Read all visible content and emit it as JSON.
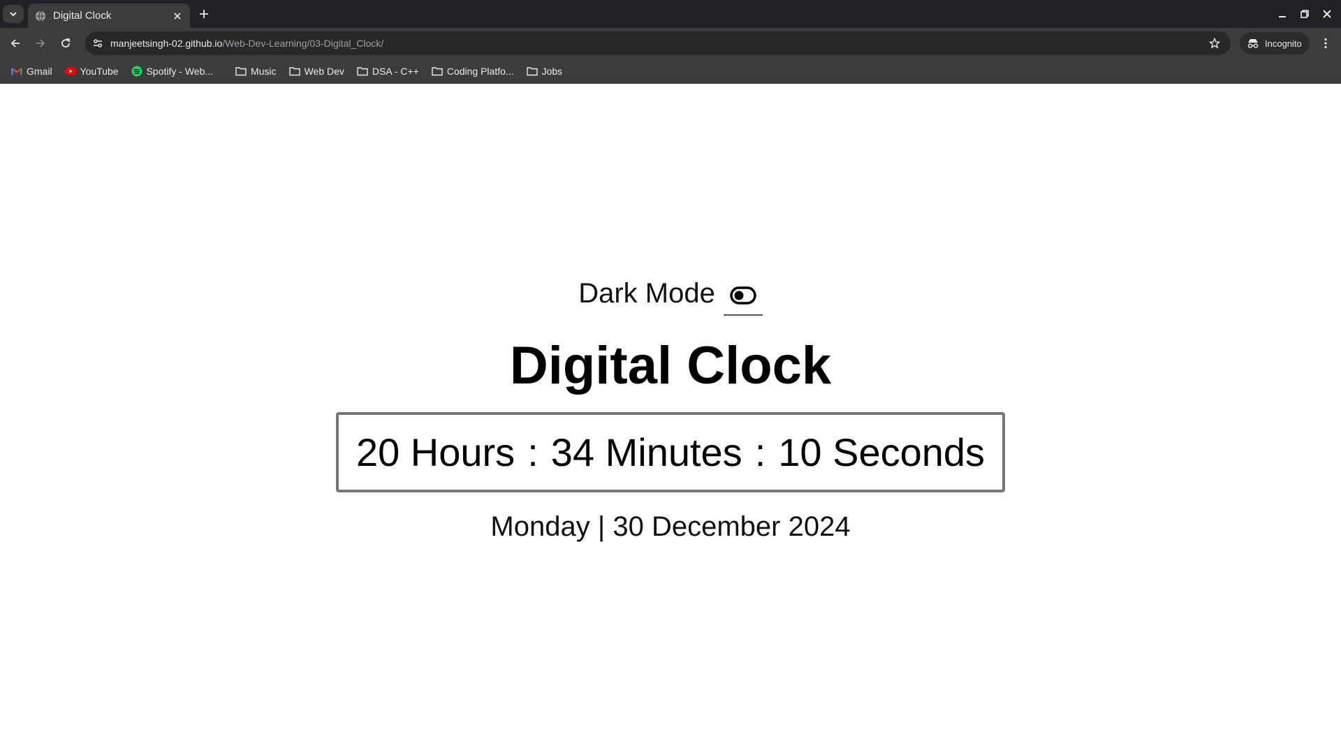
{
  "browser": {
    "tab_title": "Digital Clock",
    "url_host": "manjeetsingh-02.github.io",
    "url_path": "/Web-Dev-Learning/03-Digital_Clock/",
    "incognito_label": "Incognito",
    "bookmarks": [
      {
        "label": "Gmail",
        "icon": "gmail-icon"
      },
      {
        "label": "YouTube",
        "icon": "youtube-icon"
      },
      {
        "label": "Spotify - Web...",
        "icon": "spotify-icon"
      },
      {
        "label": "Music",
        "icon": "folder-icon"
      },
      {
        "label": "Web Dev",
        "icon": "folder-icon"
      },
      {
        "label": "DSA - C++",
        "icon": "folder-icon"
      },
      {
        "label": "Coding Platfo...",
        "icon": "folder-icon"
      },
      {
        "label": "Jobs",
        "icon": "folder-icon"
      }
    ]
  },
  "page": {
    "dark_mode_label": "Dark Mode",
    "title": "Digital Clock",
    "clock": {
      "hours": "20 Hours",
      "minutes": "34 Minutes",
      "seconds": "10 Seconds",
      "separator": ":"
    },
    "date": "Monday | 30 December 2024"
  },
  "colors": {
    "chrome_dark": "#202124",
    "toolbar": "#3c3c3c",
    "youtube_red": "#ff0000",
    "spotify_green": "#1ed760"
  }
}
